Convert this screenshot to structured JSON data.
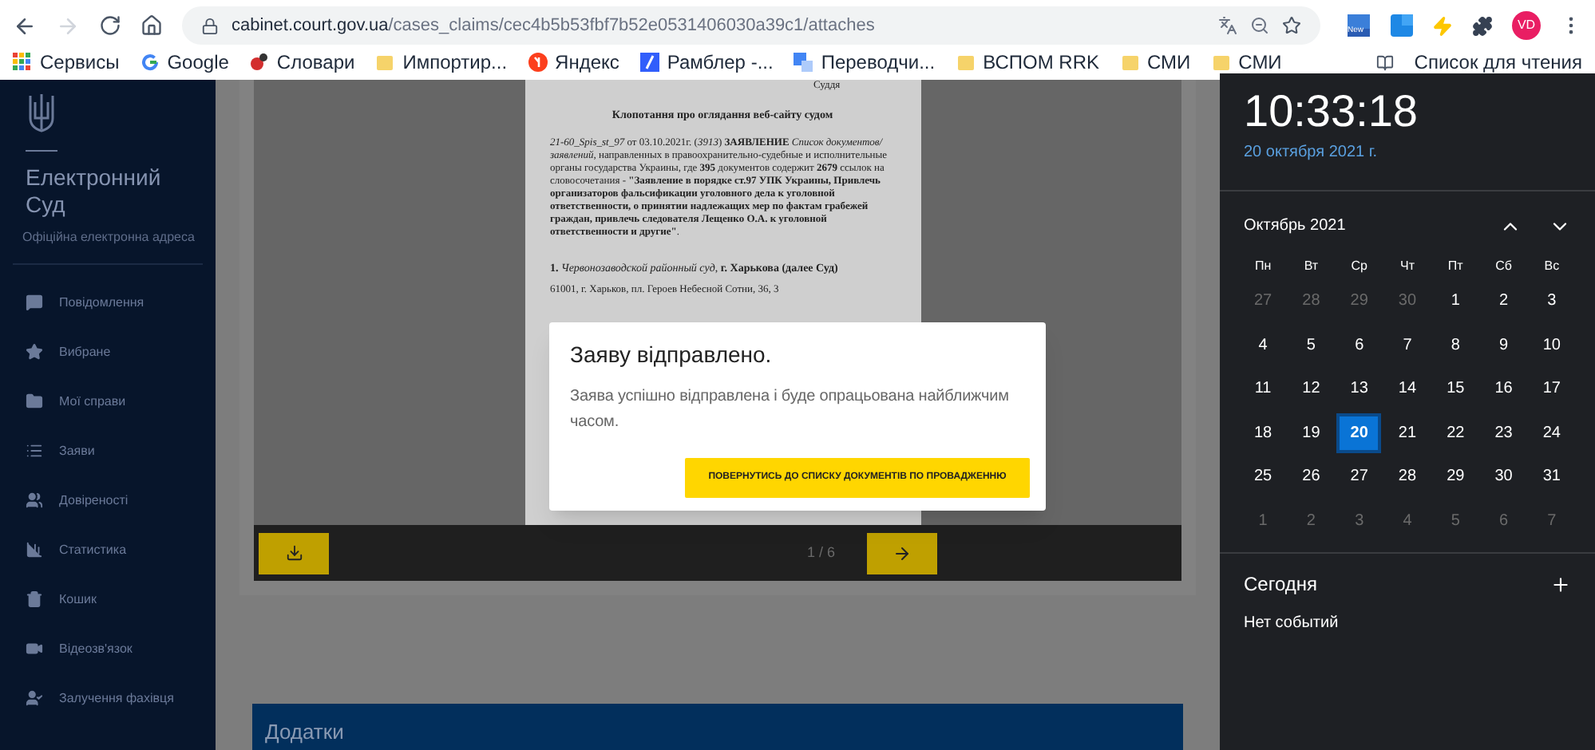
{
  "browser": {
    "url_host": "cabinet.court.gov.ua",
    "url_path": "/cases_claims/cec4b5b53fbf7b52e0531406030a39c1/attaches",
    "profile": "VD",
    "extension_badge": "New",
    "bookmarks": [
      {
        "kind": "apps",
        "label": "Сервисы"
      },
      {
        "kind": "google",
        "label": "Google"
      },
      {
        "kind": "dict",
        "label": "Словари"
      },
      {
        "kind": "folder",
        "label": "Импортир..."
      },
      {
        "kind": "yandex",
        "label": "Яндекс"
      },
      {
        "kind": "rambler",
        "label": "Рамблер -..."
      },
      {
        "kind": "translate",
        "label": "Переводчи..."
      },
      {
        "kind": "folder",
        "label": "ВСПОМ RRK"
      },
      {
        "kind": "folder",
        "label": "СМИ"
      },
      {
        "kind": "folder",
        "label": "СМИ"
      }
    ],
    "reading_list": "Список для чтения"
  },
  "sidebar": {
    "title": "Електронний Суд",
    "subtitle": "Офіційна електронна адреса",
    "items": [
      {
        "kind": "message",
        "label": "Повідомлення"
      },
      {
        "kind": "star",
        "label": "Вибране"
      },
      {
        "kind": "folder",
        "label": "Мої справи"
      },
      {
        "kind": "list",
        "label": "Заяви"
      },
      {
        "kind": "people",
        "label": "Довіреності"
      },
      {
        "kind": "chart",
        "label": "Статистика"
      },
      {
        "kind": "trash",
        "label": "Кошик"
      },
      {
        "kind": "video",
        "label": "Відеозв'язок"
      },
      {
        "kind": "expert",
        "label": "Залучення фахівця"
      }
    ]
  },
  "document": {
    "header": "Суддя",
    "title": "Клопотання про оглядання веб-сайту судом",
    "paragraph": "*21-60_Spis_st_97* от 03.10.2021г. (*3913*) **ЗАЯВЛЕНИЕ** *Список документов/ заявлений*, направленных в правоохранительно-судебные и исполнительные органы государства Украины, где **395** документов содержит **2679** ссылок на словосочетания - **\"Заявление в порядке ст.97 УПК Украины, Привлечь организаторов фальсификации уголовного дела к уголовной ответственности, о принятии надлежащих мер по фактам грабежей граждан, привлечь следователя Лещенко О.А. к уголовной ответственности и другие\"**.",
    "court": "**1.** *Червонозаводской районный суд*, **г. Харькова (далее Суд)**",
    "address": "61001, г. Харьков, пл. Героев Небесной Сотни, 36, 3"
  },
  "viewer": {
    "page_indicator": "1 / 6"
  },
  "attachments_title": "Додатки",
  "modal": {
    "title": "Заяву відправлено.",
    "message": "Заява успішно відправлена і буде опрацьована найближчим часом.",
    "button": "ПОВЕРНУТИСЬ ДО СПИСКУ ДОКУМЕНТІВ ПО ПРОВАДЖЕННЮ"
  },
  "clock": {
    "time": "10:33:18",
    "date": "20 октября 2021 г.",
    "month": "Октябрь 2021",
    "weekdays": [
      "Пн",
      "Вт",
      "Ср",
      "Чт",
      "Пт",
      "Сб",
      "Вс"
    ],
    "weeks": [
      [
        {
          "day": "27",
          "in_month": false,
          "selected": false
        },
        {
          "day": "28",
          "in_month": false,
          "selected": false
        },
        {
          "day": "29",
          "in_month": false,
          "selected": false
        },
        {
          "day": "30",
          "in_month": false,
          "selected": false
        },
        {
          "day": "1",
          "in_month": true,
          "selected": false
        },
        {
          "day": "2",
          "in_month": true,
          "selected": false
        },
        {
          "day": "3",
          "in_month": true,
          "selected": false
        }
      ],
      [
        {
          "day": "4",
          "in_month": true,
          "selected": false
        },
        {
          "day": "5",
          "in_month": true,
          "selected": false
        },
        {
          "day": "6",
          "in_month": true,
          "selected": false
        },
        {
          "day": "7",
          "in_month": true,
          "selected": false
        },
        {
          "day": "8",
          "in_month": true,
          "selected": false
        },
        {
          "day": "9",
          "in_month": true,
          "selected": false
        },
        {
          "day": "10",
          "in_month": true,
          "selected": false
        }
      ],
      [
        {
          "day": "11",
          "in_month": true,
          "selected": false
        },
        {
          "day": "12",
          "in_month": true,
          "selected": false
        },
        {
          "day": "13",
          "in_month": true,
          "selected": false
        },
        {
          "day": "14",
          "in_month": true,
          "selected": false
        },
        {
          "day": "15",
          "in_month": true,
          "selected": false
        },
        {
          "day": "16",
          "in_month": true,
          "selected": false
        },
        {
          "day": "17",
          "in_month": true,
          "selected": false
        }
      ],
      [
        {
          "day": "18",
          "in_month": true,
          "selected": false
        },
        {
          "day": "19",
          "in_month": true,
          "selected": false
        },
        {
          "day": "20",
          "in_month": true,
          "selected": true
        },
        {
          "day": "21",
          "in_month": true,
          "selected": false
        },
        {
          "day": "22",
          "in_month": true,
          "selected": false
        },
        {
          "day": "23",
          "in_month": true,
          "selected": false
        },
        {
          "day": "24",
          "in_month": true,
          "selected": false
        }
      ],
      [
        {
          "day": "25",
          "in_month": true,
          "selected": false
        },
        {
          "day": "26",
          "in_month": true,
          "selected": false
        },
        {
          "day": "27",
          "in_month": true,
          "selected": false
        },
        {
          "day": "28",
          "in_month": true,
          "selected": false
        },
        {
          "day": "29",
          "in_month": true,
          "selected": false
        },
        {
          "day": "30",
          "in_month": true,
          "selected": false
        },
        {
          "day": "31",
          "in_month": true,
          "selected": false
        }
      ],
      [
        {
          "day": "1",
          "in_month": false,
          "selected": false
        },
        {
          "day": "2",
          "in_month": false,
          "selected": false
        },
        {
          "day": "3",
          "in_month": false,
          "selected": false
        },
        {
          "day": "4",
          "in_month": false,
          "selected": false
        },
        {
          "day": "5",
          "in_month": false,
          "selected": false
        },
        {
          "day": "6",
          "in_month": false,
          "selected": false
        },
        {
          "day": "7",
          "in_month": false,
          "selected": false
        }
      ]
    ],
    "today_title": "Сегодня",
    "no_events": "Нет событий"
  }
}
